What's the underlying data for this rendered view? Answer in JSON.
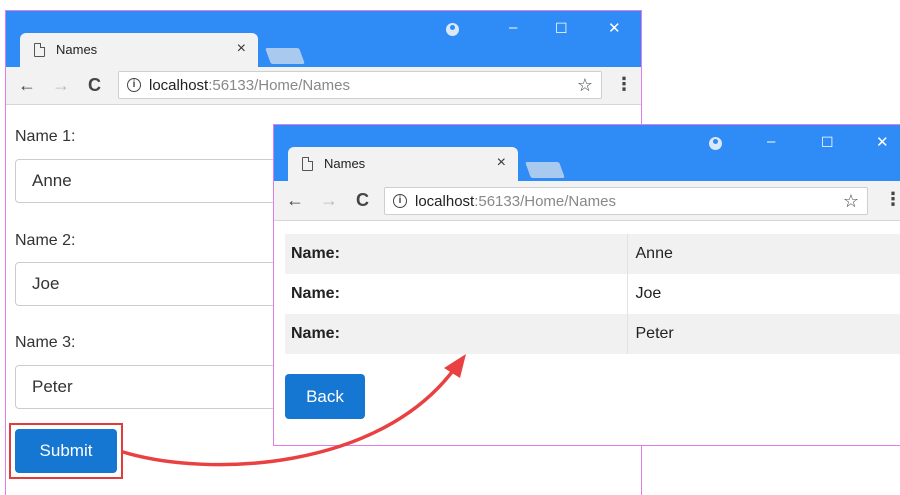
{
  "browser": {
    "tab_title": "Names",
    "tab_close": "×",
    "url_host": "localhost",
    "url_path": ":56133/Home/Names",
    "info_glyph": "i",
    "star_glyph": "☆",
    "menu_glyph": "⋮",
    "back_glyph": "←",
    "forward_glyph": "→",
    "reload_glyph": "C",
    "minimize_glyph": "–",
    "maximize_glyph": "☐",
    "close_glyph": "✕"
  },
  "form": {
    "fields": [
      {
        "label": "Name 1:",
        "value": "Anne"
      },
      {
        "label": "Name 2:",
        "value": "Joe"
      },
      {
        "label": "Name 3:",
        "value": "Peter"
      }
    ],
    "submit_label": "Submit"
  },
  "results": {
    "rows": [
      {
        "key": "Name:",
        "value": "Anne"
      },
      {
        "key": "Name:",
        "value": "Joe"
      },
      {
        "key": "Name:",
        "value": "Peter"
      }
    ],
    "back_label": "Back"
  },
  "colors": {
    "titlebar": "#2f8bf6",
    "button": "#1677d2",
    "highlight": "#e23b3b",
    "window_border": "#e27ce8"
  }
}
